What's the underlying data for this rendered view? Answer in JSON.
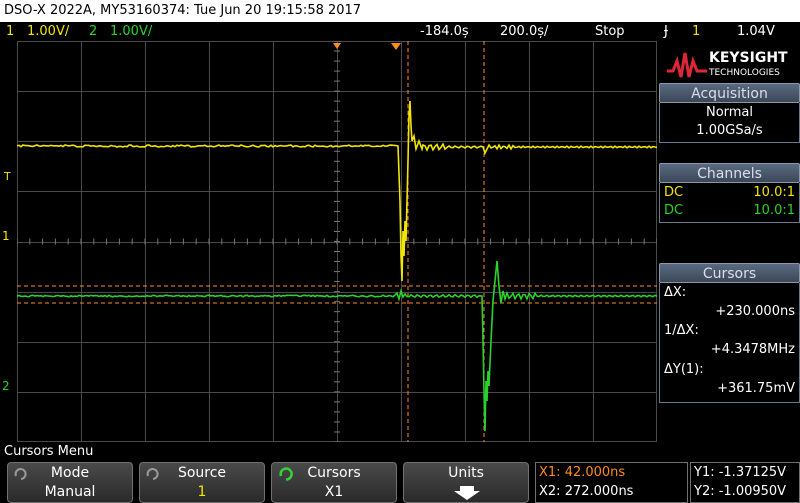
{
  "title": "DSO-X 2022A, MY53160374: Tue Jun 20 19:15:58 2017",
  "status": {
    "ch1_num": "1",
    "ch1_scale": "1.00V/",
    "ch2_num": "2",
    "ch2_scale": "1.00V/",
    "h_pos": "-184.0ș",
    "h_scale": "200.0ș/",
    "run_state": "Stop",
    "trig_slope": "Ɉ",
    "trig_ch": "1",
    "trig_level": "1.04V"
  },
  "brand": {
    "name": "KEYSIGHT",
    "sub": "TECHNOLOGIES"
  },
  "acquisition": {
    "header": "Acquisition",
    "mode": "Normal",
    "rate": "1.00GSa/s"
  },
  "channels": {
    "header": "Channels",
    "rows": [
      {
        "coupling": "DC",
        "probe": "10.0:1",
        "color": "#f2e600"
      },
      {
        "coupling": "DC",
        "probe": "10.0:1",
        "color": "#29d329"
      }
    ]
  },
  "cursors": {
    "header": "Cursors",
    "dx_label": "ΔX:",
    "dx_value": "+230.000ns",
    "inv_label": "1/ΔX:",
    "inv_value": "+4.3478MHz",
    "dy_label": "ΔY(1):",
    "dy_value": "+361.75mV"
  },
  "menu": {
    "title": "Cursors Menu",
    "softkeys": [
      {
        "label": "Mode",
        "value": "Manual"
      },
      {
        "label": "Source",
        "value": "1"
      },
      {
        "label": "Cursors",
        "value": "X1"
      },
      {
        "label": "Units",
        "value": ""
      }
    ],
    "readout_x1": "X1: 42.000ns",
    "readout_x2": "X2: 272.000ns",
    "readout_y1": "Y1: -1.37125V",
    "readout_y2": "Y2: -1.00950V"
  },
  "markers": {
    "ch1_ground": "1",
    "ch2_ground": "2",
    "trig": "T"
  },
  "colors": {
    "ch1": "#f2e600",
    "ch2": "#29d329",
    "cursor": "#ff8c1a",
    "grid": "#4a4a4a"
  }
}
